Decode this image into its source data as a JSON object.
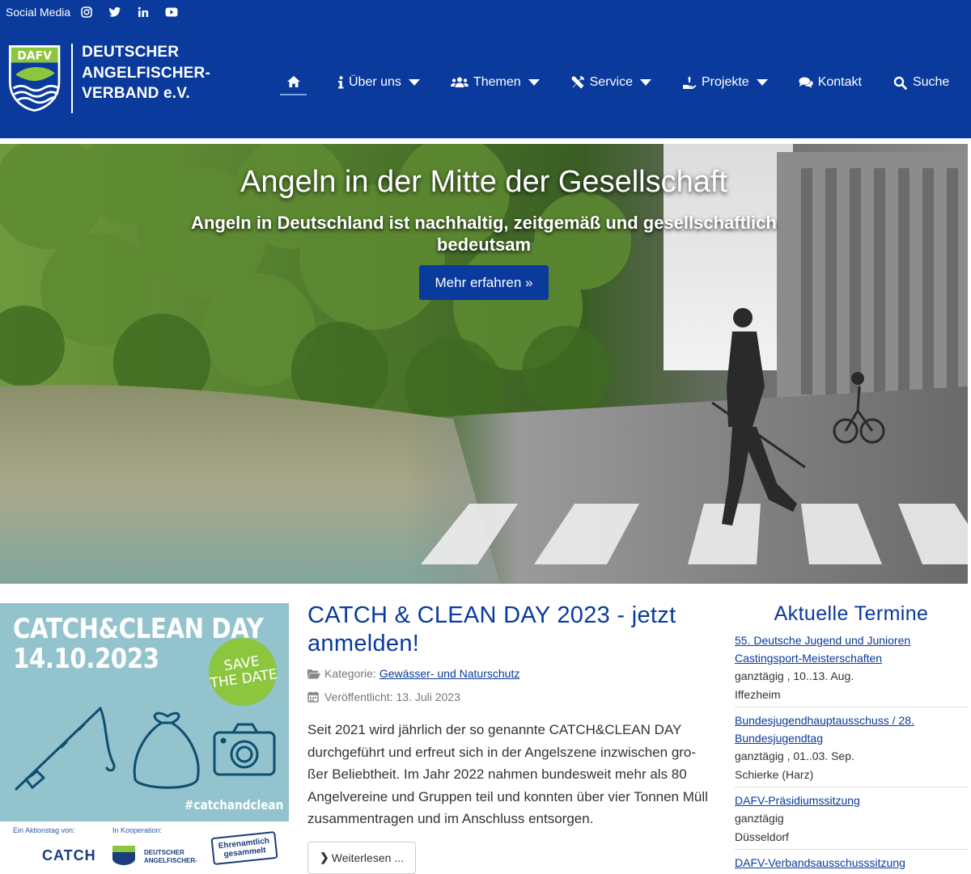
{
  "header": {
    "social_label": "Social Media",
    "social_icons": [
      "instagram-icon",
      "twitter-icon",
      "linkedin-icon",
      "youtube-icon"
    ],
    "logo": {
      "badge": "DAFV",
      "line1": "DEUTSCHER",
      "line2": "ANGELFISCHER-",
      "line3": "VERBAND e.V."
    },
    "nav": {
      "home_icon": "home-icon",
      "items": [
        {
          "label": "Über uns",
          "icon": "info-icon",
          "dropdown": true
        },
        {
          "label": "Themen",
          "icon": "users-icon",
          "dropdown": true
        },
        {
          "label": "Service",
          "icon": "tools-icon",
          "dropdown": true
        },
        {
          "label": "Projekte",
          "icon": "hand-icon",
          "dropdown": true
        },
        {
          "label": "Kontakt",
          "icon": "chat-icon",
          "dropdown": false
        },
        {
          "label": "Suche",
          "icon": "search-icon",
          "dropdown": false
        }
      ]
    },
    "colors": {
      "brand": "#0a3a9c"
    }
  },
  "hero": {
    "title": "Angeln in der Mitte der Gesellschaft",
    "subtitle": "Angeln in Deutschland ist nachhaltig, zeitgemäß und gesellschaftlich bedeutsam",
    "button": "Mehr erfahren »"
  },
  "promo": {
    "title_line1": "CATCH&CLEAN DAY",
    "title_line2": "14.10.2023",
    "save_line1": "SAVE",
    "save_line2": "THE DATE",
    "hashtag": "#catchandclean",
    "strip_left": "Ein Aktionstag von:",
    "strip_mid": "In Kooperation:",
    "strip_brand": "CATCH",
    "strip_dafv1": "DEUTSCHER",
    "strip_dafv2": "ANGELFISCHER-",
    "strip_badge_line1": "Ehrenamtlich",
    "strip_badge_line2": "gesammelt"
  },
  "article": {
    "title": "CATCH & CLEAN DAY 2023 - jetzt anmelden!",
    "category_label": "Kategorie:",
    "category_link": "Gewässer- und Naturschutz",
    "published": "Veröffentlicht: 13. Juli 2023",
    "body": "Seit 2021 wird jährlich der so genannte CATCH&CLEAN DAY durchgeführt und erfreut sich in der Angelszene inzwischen gro­ßer Beliebtheit. Im Jahr 2022 nahmen bundesweit mehr als 80 Angelvereine und Gruppen teil und konnten über vier Tonnen Müll zusammentragen und im Anschluss entsorgen.",
    "read_more": "Weiterlesen ..."
  },
  "events": {
    "heading": "Aktuelle Termine",
    "items": [
      {
        "title": "55. Deutsche Jugend und Junioren Castingsport-Meisterschaften",
        "when": "ganztägig , 10..13. Aug.",
        "where": "Iffezheim"
      },
      {
        "title": "Bundesjugendhauptausschuss / 28. Bundesjugendtag",
        "when": "ganztägig , 01..03. Sep.",
        "where": "Schierke (Harz)"
      },
      {
        "title": "DAFV-Präsidiumssitzung",
        "when": "ganztägig",
        "where": "Düsseldorf"
      },
      {
        "title": "DAFV-Verbandsausschusssitzung",
        "when": "",
        "where": ""
      }
    ]
  }
}
